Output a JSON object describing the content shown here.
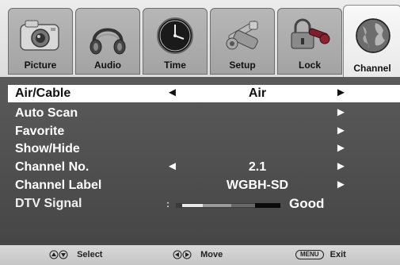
{
  "tabs": [
    {
      "label": "Picture",
      "icon": "camera-icon"
    },
    {
      "label": "Audio",
      "icon": "headphones-icon"
    },
    {
      "label": "Time",
      "icon": "clock-icon"
    },
    {
      "label": "Setup",
      "icon": "setup-tools-icon"
    },
    {
      "label": "Lock",
      "icon": "lock-key-icon"
    },
    {
      "label": "Channel",
      "icon": "globe-icon"
    }
  ],
  "active_tab": "Channel",
  "menu": {
    "air_cable": {
      "label": "Air/Cable",
      "value": "Air",
      "left": "◄",
      "right": "►"
    },
    "auto_scan": {
      "label": "Auto Scan",
      "right": "►"
    },
    "favorite": {
      "label": "Favorite",
      "right": "►"
    },
    "show_hide": {
      "label": "Show/Hide",
      "right": "►"
    },
    "channel_no": {
      "label": "Channel No.",
      "value": "2.1",
      "left": "◄",
      "right": "►"
    },
    "channel_label": {
      "label": "Channel Label",
      "value": "WGBH-SD",
      "right": "►"
    },
    "dtv_signal": {
      "label": "DTV Signal",
      "prefix": ":",
      "status": "Good"
    }
  },
  "footer": {
    "select": "Select",
    "move": "Move",
    "menu_key": "MENU",
    "exit": "Exit"
  },
  "colors": {
    "menu_bg": "#505050",
    "selected_bg": "#ffffff",
    "tab_active": "#f2f2f2",
    "tab_inactive": "#aaaaaa"
  }
}
